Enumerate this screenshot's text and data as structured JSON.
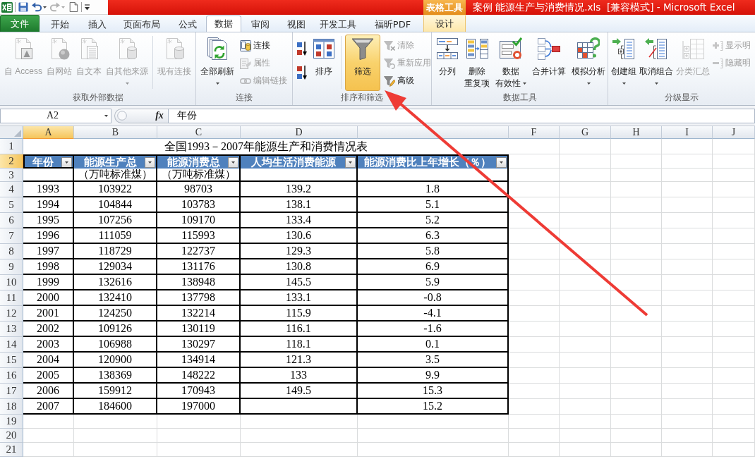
{
  "window": {
    "title": "案例 能源生产与消费情况.xls  [兼容模式] - Microsoft Excel",
    "context_group": "表格工具"
  },
  "quick_access": [
    {
      "disabled": false
    },
    {
      "disabled": false,
      "dropdown": true
    },
    {
      "disabled": true,
      "dropdown": true
    },
    {
      "disabled": false
    }
  ],
  "tabs": [
    {
      "label": "文件",
      "kind": "file",
      "selected": false
    },
    {
      "label": "开始",
      "kind": "tab",
      "selected": false
    },
    {
      "label": "插入",
      "kind": "tab",
      "selected": false
    },
    {
      "label": "页面布局",
      "kind": "tab",
      "selected": false
    },
    {
      "label": "公式",
      "kind": "tab",
      "selected": false
    },
    {
      "label": "数据",
      "kind": "tab",
      "selected": true
    },
    {
      "label": "审阅",
      "kind": "tab",
      "selected": false
    },
    {
      "label": "视图",
      "kind": "tab",
      "selected": false
    },
    {
      "label": "开发工具",
      "kind": "tab",
      "selected": false
    },
    {
      "label": "福昕PDF",
      "kind": "tab",
      "selected": false
    },
    {
      "label": "设计",
      "kind": "context",
      "selected": false
    }
  ],
  "ribbon": {
    "groups": [
      {
        "label": "获取外部数据",
        "items": [
          {
            "kind": "large",
            "lines": [
              "自 Access"
            ],
            "disabled": true
          },
          {
            "kind": "large",
            "lines": [
              "自网站"
            ],
            "disabled": true
          },
          {
            "kind": "large",
            "lines": [
              "自文本"
            ],
            "disabled": true
          },
          {
            "kind": "large",
            "lines": [
              "自其他来源"
            ],
            "disabled": true,
            "dropdown": true
          },
          {
            "kind": "large",
            "lines": [
              "现有连接"
            ],
            "disabled": true,
            "divider_before": true
          }
        ]
      },
      {
        "label": "连接",
        "items": [
          {
            "kind": "large",
            "lines": [
              "全部刷新"
            ],
            "disabled": false,
            "dropdown": true
          },
          {
            "kind": "small",
            "label": "连接",
            "disabled": false
          },
          {
            "kind": "small",
            "label": "属性",
            "disabled": true
          },
          {
            "kind": "small",
            "label": "编辑链接",
            "disabled": true
          }
        ]
      },
      {
        "label": "排序和筛选",
        "items": [
          {
            "kind": "icon",
            "disabled": false,
            "pressed": false
          },
          {
            "kind": "icon",
            "disabled": false,
            "pressed": false
          },
          {
            "kind": "large",
            "lines": [
              "排序"
            ],
            "disabled": false,
            "pressed": false
          },
          {
            "kind": "large",
            "lines": [
              "筛选"
            ],
            "disabled": false,
            "pressed": true,
            "divider_before": true
          },
          {
            "kind": "small",
            "label": "清除",
            "disabled": true,
            "pressed": false
          },
          {
            "kind": "small",
            "label": "重新应用",
            "disabled": true,
            "pressed": false
          },
          {
            "kind": "small",
            "label": "高级",
            "disabled": false,
            "pressed": false
          }
        ]
      },
      {
        "label": "数据工具",
        "items": [
          {
            "kind": "large",
            "lines": [
              "分列"
            ],
            "disabled": false
          },
          {
            "kind": "large",
            "lines": [
              "删除",
              "重复项"
            ],
            "disabled": false
          },
          {
            "kind": "large",
            "lines": [
              "数据",
              "有效性"
            ],
            "disabled": false,
            "dropdown": true
          },
          {
            "kind": "large",
            "lines": [
              "合并计算"
            ],
            "disabled": false
          },
          {
            "kind": "large",
            "lines": [
              "模拟分析"
            ],
            "disabled": false,
            "dropdown": true
          }
        ]
      },
      {
        "label": "分级显示",
        "items": [
          {
            "kind": "large",
            "lines": [
              "创建组"
            ],
            "disabled": false,
            "dropdown": true
          },
          {
            "kind": "large",
            "lines": [
              "取消组合"
            ],
            "disabled": false,
            "dropdown": true
          },
          {
            "kind": "large",
            "lines": [
              "分类汇总"
            ],
            "disabled": true
          },
          {
            "kind": "small",
            "label": "显示明",
            "disabled": true
          },
          {
            "kind": "small",
            "label": "隐藏明",
            "disabled": true
          }
        ]
      }
    ]
  },
  "formula_bar": {
    "name_box": "A2",
    "function_label": "fx",
    "value": "年份"
  },
  "sheet": {
    "columns": [
      {
        "label": "A",
        "selected": true
      },
      {
        "label": "B",
        "selected": false
      },
      {
        "label": "C",
        "selected": false
      },
      {
        "label": "D",
        "selected": false
      },
      {
        "selected": false
      },
      {
        "label": "F",
        "selected": false
      },
      {
        "label": "G",
        "selected": false
      },
      {
        "label": "H",
        "selected": false
      },
      {
        "label": "I",
        "selected": false
      },
      {
        "label": "J",
        "selected": false
      }
    ],
    "rows": [
      {
        "label": "1",
        "selected": false
      },
      {
        "label": "2",
        "selected": true
      },
      {
        "label": "3",
        "selected": false
      },
      {
        "label": "4",
        "selected": false
      },
      {
        "label": "5",
        "selected": false
      },
      {
        "label": "6",
        "selected": false
      },
      {
        "label": "7",
        "selected": false
      },
      {
        "label": "8",
        "selected": false
      },
      {
        "label": "9",
        "selected": false
      },
      {
        "label": "10",
        "selected": false
      },
      {
        "label": "11",
        "selected": false
      },
      {
        "label": "12",
        "selected": false
      },
      {
        "label": "13",
        "selected": false
      },
      {
        "label": "14",
        "selected": false
      },
      {
        "label": "15",
        "selected": false
      },
      {
        "label": "16",
        "selected": false
      },
      {
        "label": "17",
        "selected": false
      },
      {
        "label": "18",
        "selected": false
      },
      {
        "label": "19",
        "selected": false
      },
      {
        "label": "20",
        "selected": false
      },
      {
        "label": "21",
        "selected": false
      }
    ],
    "title": "全国1993－2007年能源生产和消费情况表",
    "headers": [
      {
        "label": "年份",
        "filter": true
      },
      {
        "label": "能源生产总",
        "unit": "（万吨标准煤）",
        "filter": true
      },
      {
        "label": "能源消费总",
        "unit": "（万吨标准煤）",
        "filter": true
      },
      {
        "label": "人均生活消费能源",
        "filter": true
      },
      {
        "label": "能源消费比上年增长（％）",
        "filter": true
      }
    ],
    "data": [
      {
        "A": "1993",
        "B": "103922",
        "C": "98703",
        "D": "139.2",
        "E": "1.8"
      },
      {
        "A": "1994",
        "B": "104844",
        "C": "103783",
        "D": "138.1",
        "E": "5.1"
      },
      {
        "A": "1995",
        "B": "107256",
        "C": "109170",
        "D": "133.4",
        "E": "5.2"
      },
      {
        "A": "1996",
        "B": "111059",
        "C": "115993",
        "D": "130.6",
        "E": "6.3"
      },
      {
        "A": "1997",
        "B": "118729",
        "C": "122737",
        "D": "129.3",
        "E": "5.8"
      },
      {
        "A": "1998",
        "B": "129034",
        "C": "131176",
        "D": "130.8",
        "E": "6.9"
      },
      {
        "A": "1999",
        "B": "132616",
        "C": "138948",
        "D": "145.5",
        "E": "5.9"
      },
      {
        "A": "2000",
        "B": "132410",
        "C": "137798",
        "D": "133.1",
        "E": "-0.8"
      },
      {
        "A": "2001",
        "B": "124250",
        "C": "132214",
        "D": "115.9",
        "E": "-4.1"
      },
      {
        "A": "2002",
        "B": "109126",
        "C": "130119",
        "D": "116.1",
        "E": "-1.6"
      },
      {
        "A": "2003",
        "B": "106988",
        "C": "130297",
        "D": "118.1",
        "E": "0.1"
      },
      {
        "A": "2004",
        "B": "120900",
        "C": "134914",
        "D": "121.3",
        "E": "3.5"
      },
      {
        "A": "2005",
        "B": "138369",
        "C": "148222",
        "D": "133",
        "E": "9.9"
      },
      {
        "A": "2006",
        "B": "159912",
        "C": "170943",
        "D": "149.5",
        "E": "15.3"
      },
      {
        "A": "2007",
        "B": "184600",
        "C": "197000",
        "E": "15.2"
      }
    ]
  }
}
